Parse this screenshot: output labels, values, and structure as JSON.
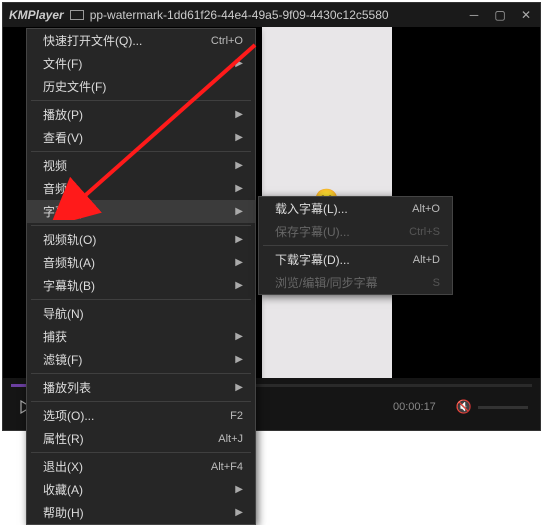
{
  "titlebar": {
    "app": "KMPlayer",
    "title": "pp-watermark-1dd61f26-44e4-49a5-9f09-4430c12c5580"
  },
  "playback": {
    "time": "00:00:17"
  },
  "menu": {
    "open_quick": "快速打开文件(Q)...",
    "open_quick_sc": "Ctrl+O",
    "files": "文件(F)",
    "history": "历史文件(F)",
    "play": "播放(P)",
    "view": "查看(V)",
    "video": "视频",
    "audio": "音频",
    "subtitle": "字幕(U)",
    "vtrack": "视频轨(O)",
    "atrack": "音频轨(A)",
    "strack": "字幕轨(B)",
    "nav": "导航(N)",
    "capture": "捕获",
    "filter": "滤镜(F)",
    "playlist": "播放列表",
    "options": "选项(O)...",
    "options_sc": "F2",
    "props": "属性(R)",
    "props_sc": "Alt+J",
    "exit": "退出(X)",
    "exit_sc": "Alt+F4",
    "fav": "收藏(A)",
    "help": "帮助(H)"
  },
  "submenu": {
    "load": "载入字幕(L)...",
    "load_sc": "Alt+O",
    "save": "保存字幕(U)...",
    "save_sc": "Ctrl+S",
    "download": "下载字幕(D)...",
    "download_sc": "Alt+D",
    "browse": "浏览/编辑/同步字幕",
    "browse_sc": "S"
  }
}
